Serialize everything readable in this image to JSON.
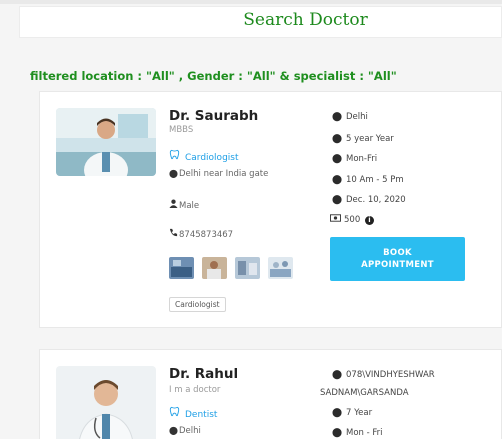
{
  "search": {
    "title": "Search Doctor"
  },
  "filter": {
    "text": "filtered location : \"All\" , Gender : \"All\" & specialist : \"All\""
  },
  "doctors": [
    {
      "name": "Dr. Saurabh",
      "qualification": "MBBS",
      "specialist": "Cardiologist",
      "address": "Delhi near India gate",
      "gender": "Male",
      "phone": "8745873467",
      "tag": "Cardiologist",
      "location": "Delhi",
      "experience": "5 year Year",
      "days": "Mon-Fri",
      "hours": "10 Am - 5 Pm",
      "date": "Dec. 10, 2020",
      "fee": "500",
      "book_label_1": "BOOK",
      "book_label_2": "APPOINTMENT"
    },
    {
      "name": "Dr. Rahul",
      "qualification": "I m a doctor",
      "specialist": "Dentist",
      "address": "Delhi",
      "location_line1": "078\\VINDHYESHWAR",
      "location_line2": "SADNAM\\GARSANDA",
      "experience": "7 Year",
      "days": "Mon - Fri"
    }
  ],
  "icons": {
    "pin": "map-pin-icon",
    "tooth": "tooth-icon",
    "user": "user-icon",
    "phone": "phone-icon",
    "money": "money-icon",
    "info": "info-icon"
  },
  "colors": {
    "accent_green": "#1f8f1f",
    "button_blue": "#2bbdf0",
    "spec_blue": "#1e9fe6"
  }
}
